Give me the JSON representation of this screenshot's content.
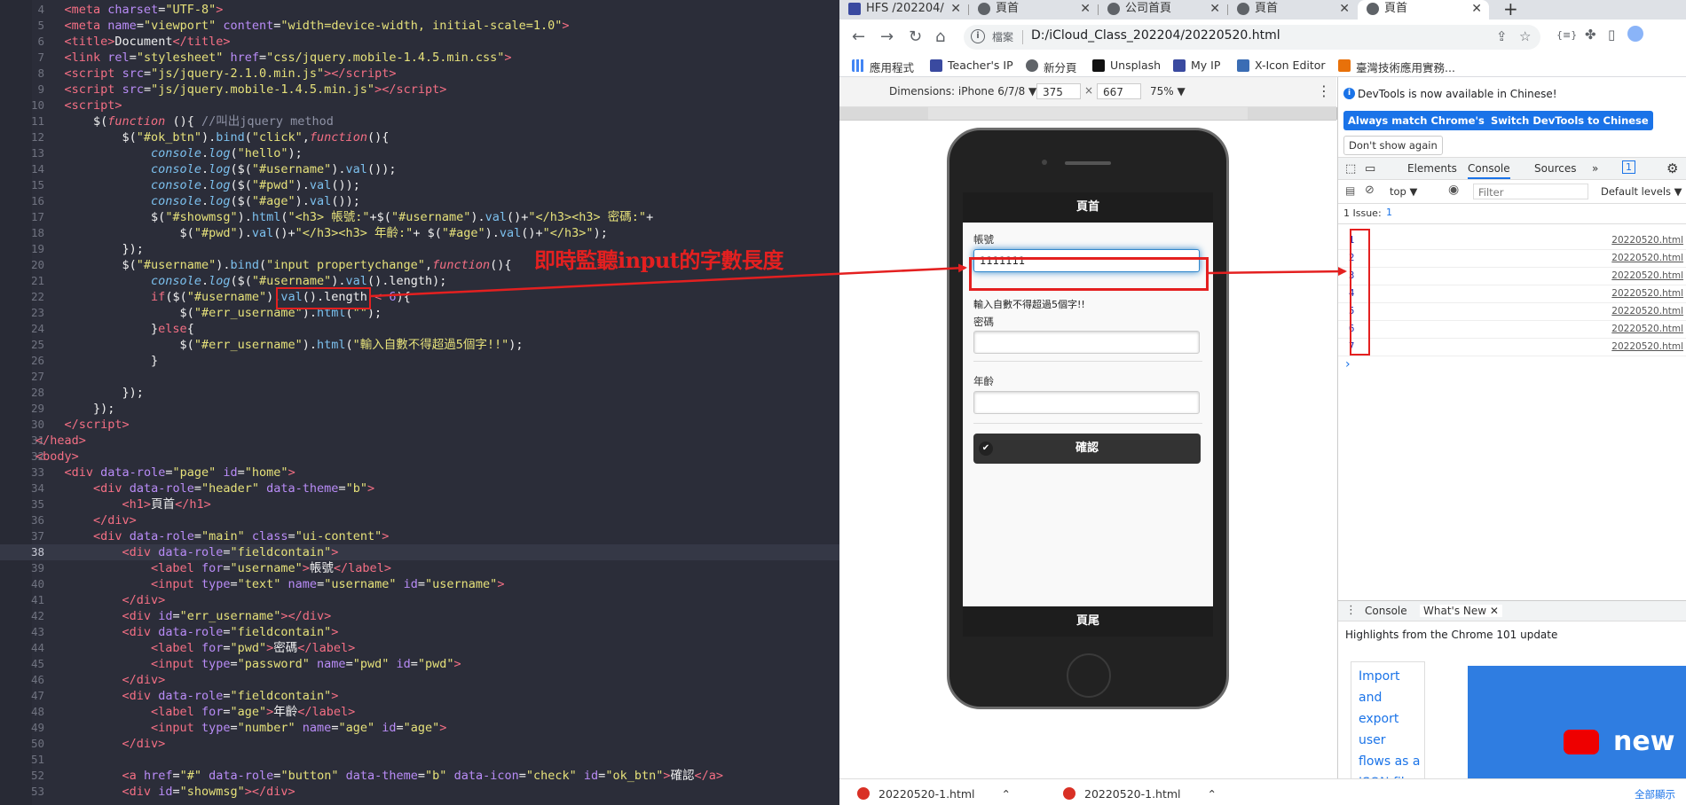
{
  "editor": {
    "lines": [
      {
        "n": "4"
      },
      {
        "n": "5"
      },
      {
        "n": "6"
      },
      {
        "n": "7"
      },
      {
        "n": "8"
      },
      {
        "n": "9"
      },
      {
        "n": "10"
      },
      {
        "n": "11"
      },
      {
        "n": "12"
      },
      {
        "n": "13"
      },
      {
        "n": "14"
      },
      {
        "n": "15"
      },
      {
        "n": "16"
      },
      {
        "n": "17"
      },
      {
        "n": "18"
      },
      {
        "n": "19"
      },
      {
        "n": "20"
      },
      {
        "n": "21"
      },
      {
        "n": "22"
      },
      {
        "n": "23"
      },
      {
        "n": "24"
      },
      {
        "n": "25"
      },
      {
        "n": "26"
      },
      {
        "n": "27"
      },
      {
        "n": "28"
      },
      {
        "n": "29"
      },
      {
        "n": "30"
      },
      {
        "n": "31"
      },
      {
        "n": "32"
      },
      {
        "n": "33"
      },
      {
        "n": "34"
      },
      {
        "n": "35"
      },
      {
        "n": "36"
      },
      {
        "n": "37"
      },
      {
        "n": "38"
      },
      {
        "n": "39"
      },
      {
        "n": "40"
      },
      {
        "n": "41"
      },
      {
        "n": "42"
      },
      {
        "n": "43"
      },
      {
        "n": "44"
      },
      {
        "n": "45"
      },
      {
        "n": "46"
      },
      {
        "n": "47"
      },
      {
        "n": "48"
      },
      {
        "n": "49"
      },
      {
        "n": "50"
      },
      {
        "n": "51"
      },
      {
        "n": "52"
      },
      {
        "n": "53"
      }
    ],
    "annotation": "即時監聽input的字數長度"
  },
  "browser": {
    "tabs": [
      "HFS /202204/",
      "頁首",
      "公司首頁",
      "頁首",
      "頁首"
    ],
    "url_prefix": "檔案",
    "url": "D:/iCloud_Class_202204/20220520.html",
    "bookmarks": [
      "應用程式",
      "Teacher's IP",
      "新分頁",
      "Unsplash",
      "My IP",
      "X-Icon Editor",
      "臺灣技術應用實務..."
    ],
    "device": {
      "label": "Dimensions: iPhone 6/7/8 ▼",
      "width": "375",
      "height": "667",
      "zoom": "75% ▼"
    },
    "page": {
      "header": "頁首",
      "username_label": "帳號",
      "username_value": "1111111",
      "err_username": "輸入自數不得超過5個字!!",
      "pwd_label": "密碼",
      "age_label": "年齡",
      "ok_button": "確認",
      "footer": "頁尾"
    },
    "downloads": [
      "20220520-1.html",
      "20220520-1.html",
      "全部顯示"
    ]
  },
  "devtools": {
    "notice": "DevTools is now available in Chinese!",
    "btn_match": "Always match Chrome's language",
    "btn_switch": "Switch DevTools to Chinese",
    "btn_dont_show": "Don't show again",
    "tabs": [
      "Elements",
      "Console",
      "Sources",
      "»"
    ],
    "issue_count": "1",
    "context": "top ▼",
    "filter_placeholder": "Filter",
    "levels": "Default levels ▼",
    "issues_label": "1 Issue:",
    "console_rows": [
      {
        "value": "1",
        "src": "20220520.html"
      },
      {
        "value": "2",
        "src": "20220520.html"
      },
      {
        "value": "3",
        "src": "20220520.html"
      },
      {
        "value": "4",
        "src": "20220520.html"
      },
      {
        "value": "5",
        "src": "20220520.html"
      },
      {
        "value": "6",
        "src": "20220520.html"
      },
      {
        "value": "7",
        "src": "20220520.html"
      }
    ],
    "prompt": "›",
    "drawer_tabs": [
      "Console",
      "What's New ✕"
    ],
    "whatsnew_title": "Highlights from the Chrome 101 update",
    "whatsnew_link": "Import and export user flows as a JSON file",
    "whatsnew_img_text": "new"
  },
  "colors": {
    "annotation": "#e42020",
    "editor_bg": "#2b2d39",
    "devtools_blue": "#1a73e8"
  }
}
